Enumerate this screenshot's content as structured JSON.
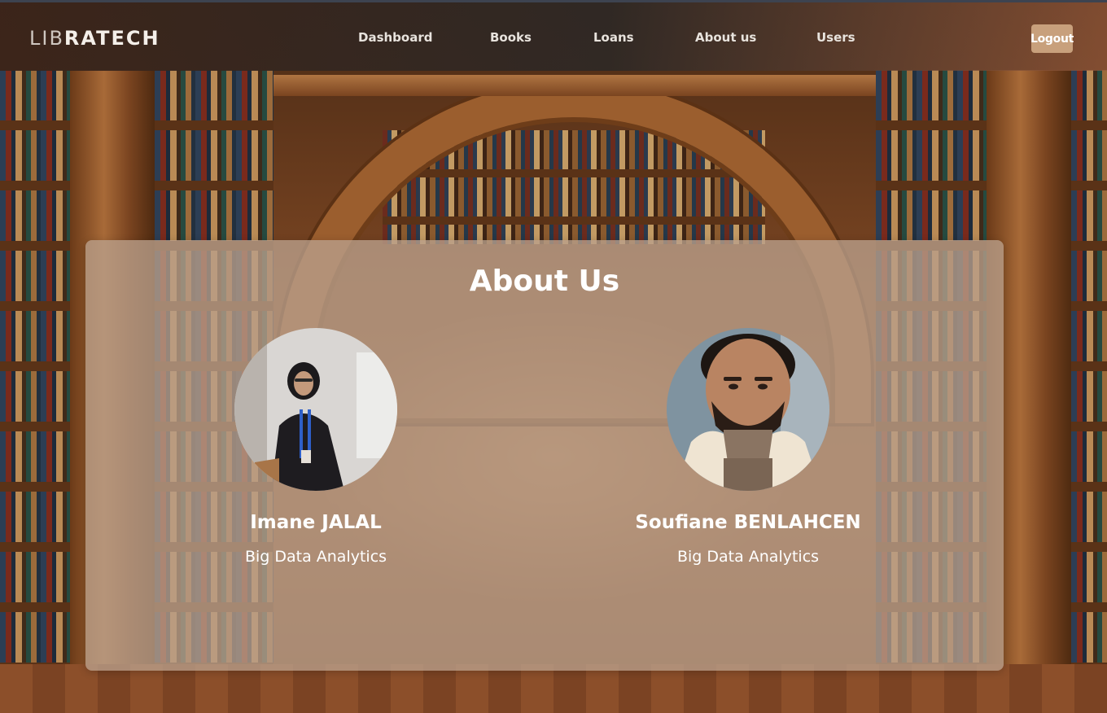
{
  "brand": {
    "part1": "LIB",
    "part2": "RATECH"
  },
  "nav": {
    "items": [
      {
        "label": "Dashboard"
      },
      {
        "label": "Books"
      },
      {
        "label": "Loans"
      },
      {
        "label": "About us"
      },
      {
        "label": "Users"
      }
    ],
    "logout_label": "Logout"
  },
  "about": {
    "title": "About Us",
    "members": [
      {
        "name": "Imane JALAL",
        "role": "Big Data Analytics",
        "avatar_icon": "person-photo"
      },
      {
        "name": "Soufiane BENLAHCEN",
        "role": "Big Data Analytics",
        "avatar_icon": "person-photo"
      }
    ]
  },
  "colors": {
    "logout_bg": "#c8a07c",
    "card_bg": "rgba(186,160,140,0.78)",
    "text": "#ffffff"
  }
}
